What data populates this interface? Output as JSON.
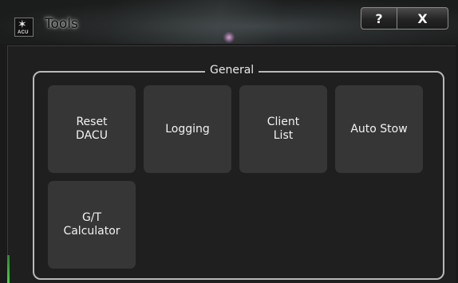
{
  "window": {
    "title": "Tools",
    "app_icon": "acu-star-icon",
    "app_icon_text": "ACU",
    "help_label": "?",
    "close_label": "X"
  },
  "group": {
    "title": "General",
    "buttons": [
      {
        "label": "Reset\nDACU"
      },
      {
        "label": "Logging"
      },
      {
        "label": "Client\nList"
      },
      {
        "label": "Auto Stow"
      },
      {
        "label": "G/T\nCalculator"
      }
    ]
  },
  "colors": {
    "button_bg": "#363636",
    "group_border": "#b9b9b9",
    "window_bg": "#1f1f1f"
  }
}
